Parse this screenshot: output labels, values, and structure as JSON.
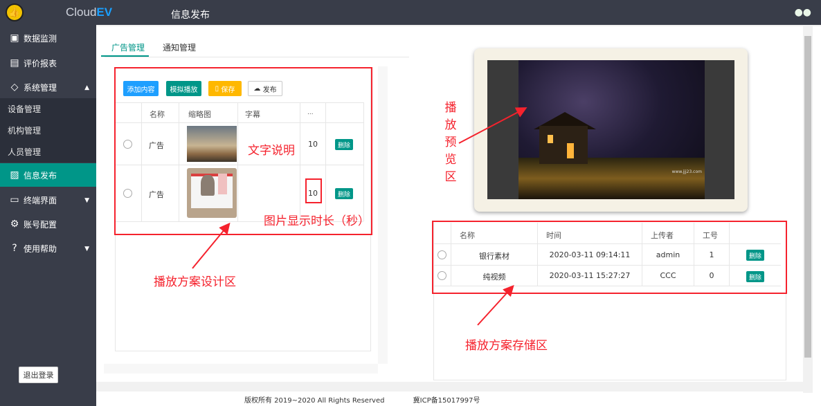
{
  "header": {
    "brand_prefix": "Cloud",
    "brand_suffix": "EV",
    "title": "信息发布"
  },
  "sidebar": {
    "items": [
      {
        "label": "数据监测",
        "icon": "monitor-icon"
      },
      {
        "label": "评价报表",
        "icon": "report-icon"
      },
      {
        "label": "系统管理",
        "icon": "diamond-icon"
      },
      {
        "label": "设备管理"
      },
      {
        "label": "机构管理"
      },
      {
        "label": "人员管理"
      },
      {
        "label": "信息发布",
        "icon": "image-icon"
      },
      {
        "label": "终端界面",
        "icon": "screen-icon"
      },
      {
        "label": "账号配置",
        "icon": "gear-icon"
      },
      {
        "label": "使用帮助",
        "icon": "help-icon"
      }
    ],
    "logout": "退出登录"
  },
  "tabs": {
    "ad": "广告管理",
    "notice": "通知管理"
  },
  "toolbar": {
    "add": "添加内容",
    "simulate": "模拟播放",
    "save": "保存",
    "publish": "发布"
  },
  "design_table": {
    "headers": {
      "name": "名称",
      "thumb": "缩略图",
      "caption": "字幕",
      "dots": "..."
    },
    "rows": [
      {
        "name": "广告",
        "duration": "10",
        "delete": "删除"
      },
      {
        "name": "广告",
        "duration": "10",
        "delete": "删除"
      }
    ]
  },
  "storage_table": {
    "headers": {
      "name": "名称",
      "time": "时间",
      "uploader": "上传者",
      "num": "工号"
    },
    "rows": [
      {
        "name": "银行素材",
        "time": "2020-03-11 09:14:11",
        "uploader": "admin",
        "num": "1",
        "delete": "删除"
      },
      {
        "name": "纯视频",
        "time": "2020-03-11 15:27:27",
        "uploader": "CCC",
        "num": "0",
        "delete": "删除"
      }
    ]
  },
  "annotations": {
    "text_desc": "文字说明",
    "image_duration": "图片显示时长（秒）",
    "design_area": "播放方案设计区",
    "storage_area": "播放方案存储区",
    "preview": [
      "播",
      "放",
      "预",
      "览",
      "区"
    ]
  },
  "preview": {
    "watermark": "www.jjj23.com"
  },
  "footer": {
    "copyright": "版权所有 2019~2020 All Rights Reserved",
    "icp": "冀ICP备15017997号"
  },
  "colors": {
    "topbar": "#393d49",
    "accent": "#009688",
    "blue": "#1e9fff",
    "yellow": "#ffb800",
    "annotation": "#f5222d"
  }
}
